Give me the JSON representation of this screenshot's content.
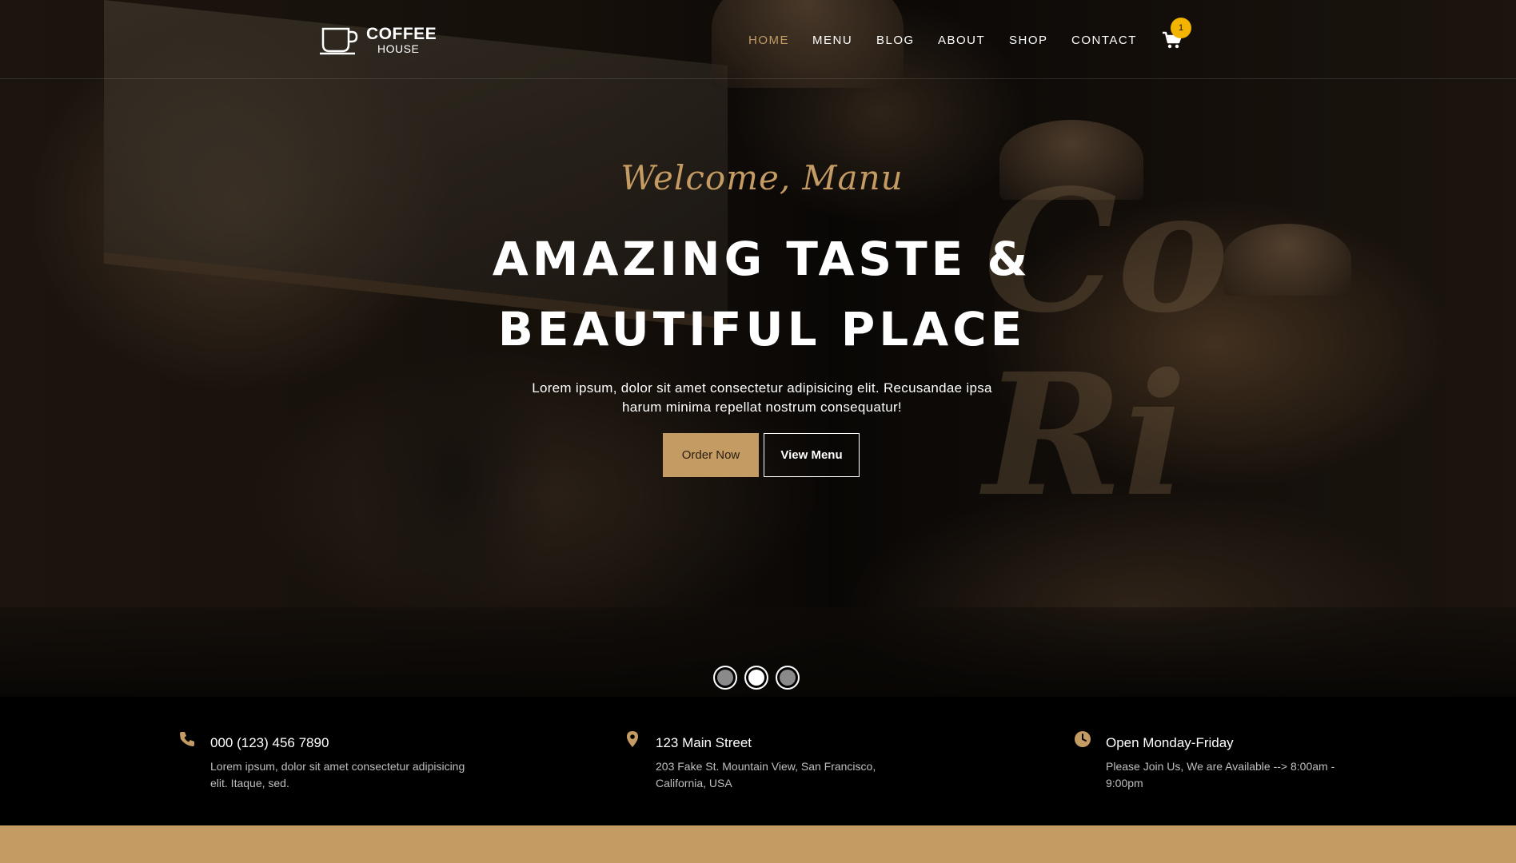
{
  "brand": {
    "title": "COFFEE",
    "subtitle": "HOUSE",
    "logo_icon": "coffee-cup-icon"
  },
  "nav": {
    "items": [
      {
        "label": "HOME",
        "active": true
      },
      {
        "label": "MENU",
        "active": false
      },
      {
        "label": "BLOG",
        "active": false
      },
      {
        "label": "ABOUT",
        "active": false
      },
      {
        "label": "SHOP",
        "active": false
      },
      {
        "label": "CONTACT",
        "active": false
      }
    ],
    "cart_icon": "shopping-cart-icon",
    "cart_count": "1"
  },
  "hero": {
    "welcome": "Welcome, Manu",
    "headline_line1": "AMAZING TASTE &",
    "headline_line2": "BEAUTIFUL PLACE",
    "tagline": "Lorem ipsum, dolor sit amet consectetur adipisicing elit. Recusandae ipsa harum minima repellat nostrum consequatur!",
    "order_button": "Order Now",
    "menu_button": "View Menu",
    "slides": 3,
    "active_slide": 2
  },
  "info": {
    "phone": {
      "icon": "phone-icon",
      "title": "000 (123) 456 7890",
      "text": "Lorem ipsum, dolor sit amet consectetur adipisicing elit. Itaque, sed."
    },
    "address": {
      "icon": "map-pin-icon",
      "title": "123 Main Street",
      "text": "203 Fake St. Mountain View, San Francisco, California, USA"
    },
    "hours": {
      "icon": "clock-icon",
      "title": "Open Monday-Friday",
      "text": "Please Join Us, We are Available --> 8:00am - 9:00pm"
    }
  },
  "colors": {
    "accent": "#c49b63",
    "badge": "#f3b400",
    "background": "#000000"
  }
}
